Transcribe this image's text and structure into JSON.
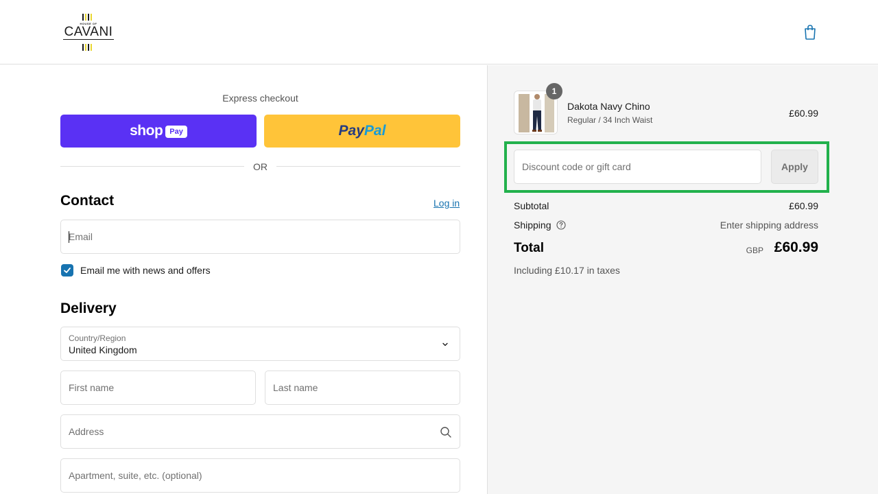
{
  "header": {
    "logo": {
      "small_text": "HOUSE OF",
      "word": "CAVANI",
      "bar_colors": [
        "#1a1a1a",
        "#e8d630",
        "#1a1a1a",
        "#e8d630"
      ]
    },
    "cart_icon": "shopping-bag-icon"
  },
  "express": {
    "title": "Express checkout",
    "shop_pay": {
      "word": "shop",
      "pill": "Pay",
      "color": "#5a31f4"
    },
    "paypal": {
      "word_a": "Pay",
      "word_b": "Pal",
      "color": "#ffc439"
    },
    "or_text": "OR"
  },
  "contact": {
    "heading": "Contact",
    "login_link": "Log in",
    "email_placeholder": "Email",
    "newsletter_label": "Email me with news and offers",
    "newsletter_checked": true
  },
  "delivery": {
    "heading": "Delivery",
    "country_label": "Country/Region",
    "country_value": "United Kingdom",
    "first_name_placeholder": "First name",
    "last_name_placeholder": "Last name",
    "address_placeholder": "Address",
    "apartment_placeholder": "Apartment, suite, etc. (optional)"
  },
  "summary": {
    "item": {
      "quantity": "1",
      "name": "Dakota Navy Chino",
      "variant": "Regular / 34 Inch Waist",
      "price": "£60.99"
    },
    "discount_placeholder": "Discount code or gift card",
    "apply_label": "Apply",
    "subtotal_label": "Subtotal",
    "subtotal_value": "£60.99",
    "shipping_label": "Shipping",
    "shipping_value": "Enter shipping address",
    "total_label": "Total",
    "total_currency": "GBP",
    "total_value": "£60.99",
    "taxes_note": "Including £10.17 in taxes"
  },
  "colors": {
    "accent": "#1773b0",
    "highlight_box": "#22b14c",
    "summary_bg": "#f5f5f5"
  }
}
